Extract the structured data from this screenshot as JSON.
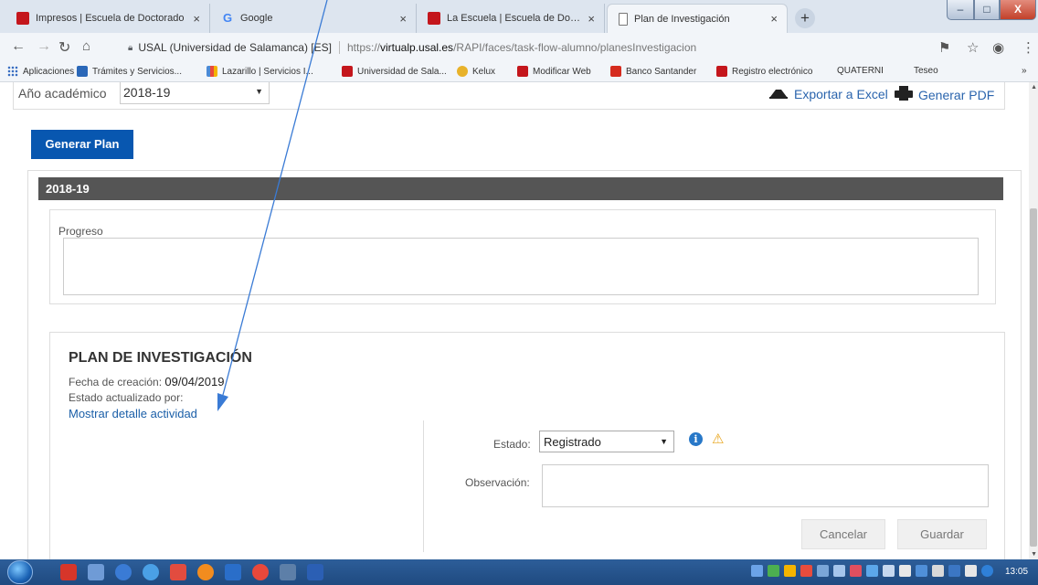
{
  "browser": {
    "tabs": [
      {
        "label": "Impresos | Escuela de Doctorado",
        "favicon": "usal-logo-icon"
      },
      {
        "label": "Google",
        "favicon": "google-icon"
      },
      {
        "label": "La Escuela | Escuela de Doctorado",
        "favicon": "usal-logo-icon"
      },
      {
        "label": "Plan de Investigación",
        "favicon": "page-icon",
        "active": true
      }
    ],
    "new_tab": "+",
    "address": {
      "org": "USAL (Universidad de Salamanca) [ES]",
      "prefix": "https://",
      "host": "virtualp.usal.es",
      "path": "/RAPI/faces/task-flow-alumno/planesInvestigacion"
    },
    "bookmarks": [
      {
        "label": "Aplicaciones",
        "icon": "apps-grid-icon"
      },
      {
        "label": "Trámites y Servicios...",
        "icon": "tramites-icon"
      },
      {
        "label": "Lazarillo | Servicios I...",
        "icon": "lazarillo-icon"
      },
      {
        "label": "Universidad de Sala...",
        "icon": "usal-logo-icon"
      },
      {
        "label": "Kelux",
        "icon": "kelux-icon"
      },
      {
        "label": "Modificar Web",
        "icon": "usal-logo-icon"
      },
      {
        "label": "Banco Santander",
        "icon": "santander-icon"
      },
      {
        "label": "Registro electrónico",
        "icon": "usal-logo-icon"
      },
      {
        "label": "QUATERNI",
        "icon": "page-icon"
      },
      {
        "label": "Teseo",
        "icon": "page-icon"
      }
    ],
    "bookmarks_overflow": "»"
  },
  "page": {
    "year_label": "Año académico",
    "year_value": "2018-19",
    "export_excel": "Exportar a Excel",
    "export_pdf": "Generar PDF",
    "generate_plan": "Generar Plan",
    "year_header": "2018-19",
    "progress_label": "Progreso",
    "plan": {
      "title": "PLAN DE INVESTIGACIÓN",
      "created_label": "Fecha de creación:",
      "created_value": "09/04/2019",
      "updated_label": "Estado actualizado por:",
      "detail_link": "Mostrar detalle actividad"
    },
    "status": {
      "label": "Estado:",
      "value": "Registrado",
      "observation_label": "Observación:"
    },
    "buttons": {
      "cancel": "Cancelar",
      "save": "Guardar"
    }
  },
  "taskbar": {
    "clock": "13:05"
  },
  "colors": {
    "primary": "#0857b0",
    "header_bar": "#555555",
    "link": "#1b5fa8",
    "annotation_arrow": "#3a7bd5",
    "warning": "#e8a317"
  }
}
